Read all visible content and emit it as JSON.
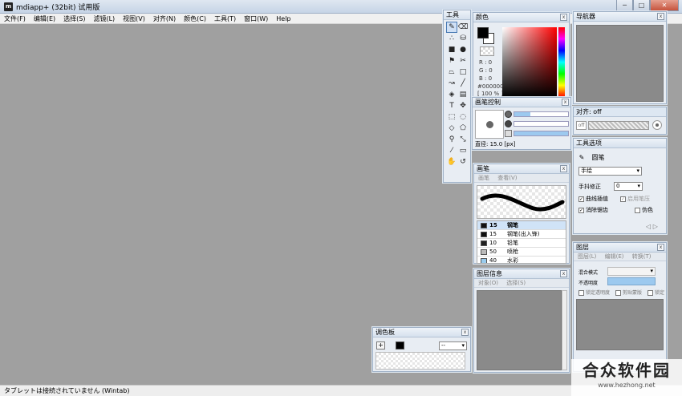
{
  "window": {
    "title": "mdiapp+ (32bit) 试用版",
    "app_icon": "m",
    "minimize": "─",
    "maximize": "□",
    "close": "✕"
  },
  "menu": [
    "文件(F)",
    "编辑(E)",
    "选择(S)",
    "滤镜(L)",
    "视图(V)",
    "对齐(N)",
    "颜色(C)",
    "工具(T)",
    "窗口(W)",
    "Help"
  ],
  "status": "タブレットは接続されていません (Wintab)",
  "tools_panel": {
    "title": "工具",
    "tools": [
      {
        "icon": "pen-icon",
        "glyph": "✎"
      },
      {
        "icon": "eraser-icon",
        "glyph": "⌫"
      },
      {
        "icon": "dot-brush-icon",
        "glyph": "∴"
      },
      {
        "icon": "fill-icon",
        "glyph": "⛁"
      },
      {
        "icon": "square-icon",
        "glyph": "■"
      },
      {
        "icon": "circle-icon",
        "glyph": "●"
      },
      {
        "icon": "flag-icon",
        "glyph": "⚑"
      },
      {
        "icon": "scissors-icon",
        "glyph": "✂"
      },
      {
        "icon": "trapezoid-icon",
        "glyph": "⏢"
      },
      {
        "icon": "rect-outline-icon",
        "glyph": "□"
      },
      {
        "icon": "curve-icon",
        "glyph": "↝"
      },
      {
        "icon": "line-icon",
        "glyph": "╱"
      },
      {
        "icon": "bucket-icon",
        "glyph": "◈"
      },
      {
        "icon": "gradient-icon",
        "glyph": "▤"
      },
      {
        "icon": "text-icon",
        "glyph": "T"
      },
      {
        "icon": "move-icon",
        "glyph": "✥"
      },
      {
        "icon": "rect-select-icon",
        "glyph": "⬚"
      },
      {
        "icon": "ellipse-select-icon",
        "glyph": "◌"
      },
      {
        "icon": "lasso-icon",
        "glyph": "◇"
      },
      {
        "icon": "poly-select-icon",
        "glyph": "⬠"
      },
      {
        "icon": "zoom-icon",
        "glyph": "⚲"
      },
      {
        "icon": "transform-icon",
        "glyph": "⤡"
      },
      {
        "icon": "eyedropper-icon",
        "glyph": "⁄"
      },
      {
        "icon": "ruler-icon",
        "glyph": "▭"
      },
      {
        "icon": "hand-icon",
        "glyph": "✋"
      },
      {
        "icon": "rotate-icon",
        "glyph": "↺"
      }
    ]
  },
  "color_panel": {
    "title": "颜色",
    "r": "R : 0",
    "g": "G : 0",
    "b": "B : 0",
    "hex": "#000000",
    "opacity": "[ 100 % ]"
  },
  "brush_control": {
    "title": "画笔控制",
    "diameter": "直径: 15.0 [px]"
  },
  "brush_panel": {
    "title": "画笔",
    "tabs": [
      "画笔",
      "查看(V)"
    ],
    "rows": [
      {
        "size": "15",
        "name": "钢笔",
        "color": "#111111",
        "selected": true
      },
      {
        "size": "15",
        "name": "钢笔(出入锋)",
        "color": "#111111",
        "selected": false
      },
      {
        "size": "10",
        "name": "铅笔",
        "color": "#222222",
        "selected": false
      },
      {
        "size": "50",
        "name": "喷枪",
        "color": "#bbbbbb",
        "selected": false
      },
      {
        "size": "40",
        "name": "水彩",
        "color": "#99ccee",
        "selected": false
      }
    ]
  },
  "layer_info": {
    "title": "图层信息",
    "tabs": [
      "对象(O)",
      "选择(S)"
    ]
  },
  "palette": {
    "title": "调色板",
    "add": "+",
    "select": "--"
  },
  "navigator": {
    "title": "导航器"
  },
  "snap": {
    "title": "对齐: off",
    "off_label": "off"
  },
  "tool_options": {
    "title": "工具选项",
    "tool_name": "圆笔",
    "mode": "手绘",
    "correction_label": "手抖修正",
    "correction_value": "0",
    "curve_interp": "曲线插值",
    "pen_pressure": "启用笔压",
    "anti_alias": "消除锯齿",
    "simulate": "伪色"
  },
  "layers": {
    "title": "图层",
    "tabs": [
      "图层(L)",
      "编辑(E)",
      "转换(T)"
    ],
    "blend_label": "混合模式",
    "opacity_label": "不透明度",
    "lock_alpha": "锁定透明度",
    "clip": "剪贴蒙版",
    "lock": "锁定"
  },
  "watermark": {
    "main": "合众软件园",
    "url": "www.hezhong.net"
  }
}
